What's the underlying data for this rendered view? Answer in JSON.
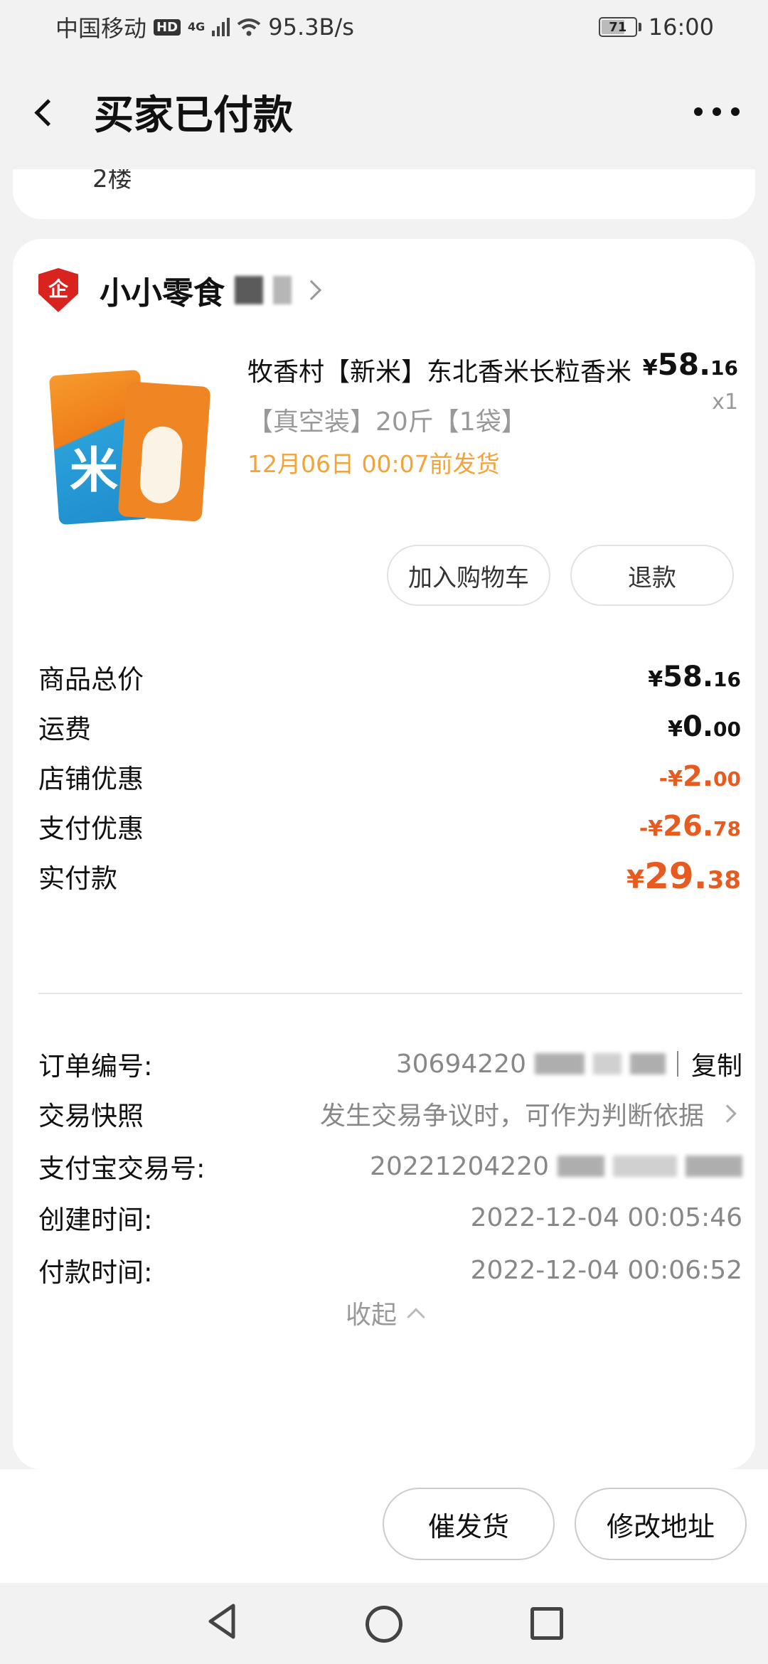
{
  "status_bar": {
    "carrier": "中国移动",
    "hd": "HD",
    "network": "4G",
    "speed": "95.3B/s",
    "battery": "71",
    "time": "16:00"
  },
  "header": {
    "title": "买家已付款"
  },
  "previous_card": {
    "text": "2楼"
  },
  "shop": {
    "icon_text": "企",
    "name": "小小零食"
  },
  "product": {
    "title": "牧香村【新米】东北香米长粒香米",
    "price_symbol": "¥",
    "price_int": "58.",
    "price_dec": "16",
    "quantity": "x1",
    "sku": "【真空装】20斤【1袋】",
    "ship_note": "12月06日 00:07前发货",
    "image_char": "米"
  },
  "actions": {
    "add_to_cart": "加入购物车",
    "refund": "退款"
  },
  "amounts": [
    {
      "label": "商品总价",
      "prefix": "¥",
      "int": "58.",
      "dec": "16"
    },
    {
      "label": "运费",
      "prefix": "¥",
      "int": "0.",
      "dec": "00"
    },
    {
      "label": "店铺优惠",
      "prefix": "-¥",
      "int": "2.",
      "dec": "00"
    },
    {
      "label": "支付优惠",
      "prefix": "-¥",
      "int": "26.",
      "dec": "78"
    },
    {
      "label": "实付款",
      "prefix": "¥",
      "int": "29.",
      "dec": "38"
    }
  ],
  "order_info": {
    "order_no_label": "订单编号:",
    "order_no_visible": "30694220",
    "copy_label": "复制",
    "snapshot_label": "交易快照",
    "snapshot_text": "发生交易争议时，可作为判断依据",
    "alipay_label": "支付宝交易号:",
    "alipay_visible": "20221204220",
    "created_label": "创建时间:",
    "created_value": "2022-12-04 00:05:46",
    "paid_label": "付款时间:",
    "paid_value": "2022-12-04 00:06:52",
    "collapse_label": "收起"
  },
  "bottom_actions": {
    "urge_ship": "催发货",
    "change_address": "修改地址"
  },
  "colors": {
    "accent": "#e85b20",
    "ship_note": "#f2a33a",
    "shop_badge": "#d8231f"
  }
}
